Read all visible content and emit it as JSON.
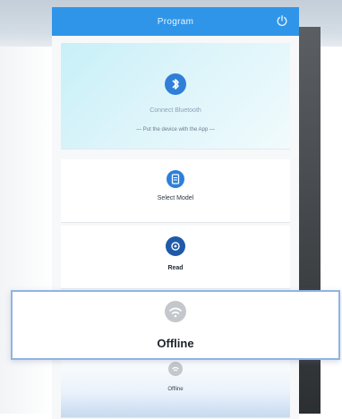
{
  "header": {
    "title": "Program"
  },
  "bluetooth": {
    "label": "Connect Bluetooth",
    "hint": "— Put the device with the App —"
  },
  "model": {
    "label": "Select Model"
  },
  "read": {
    "label": "Read"
  },
  "offline_card": {
    "label": "Offline"
  },
  "offline_item": {
    "label": "Offline"
  },
  "colors": {
    "accent": "#2f95e8",
    "icon_blue": "#2f7fd8",
    "icon_dark": "#1e5aa8",
    "offline_grey": "#c4c8cc"
  }
}
